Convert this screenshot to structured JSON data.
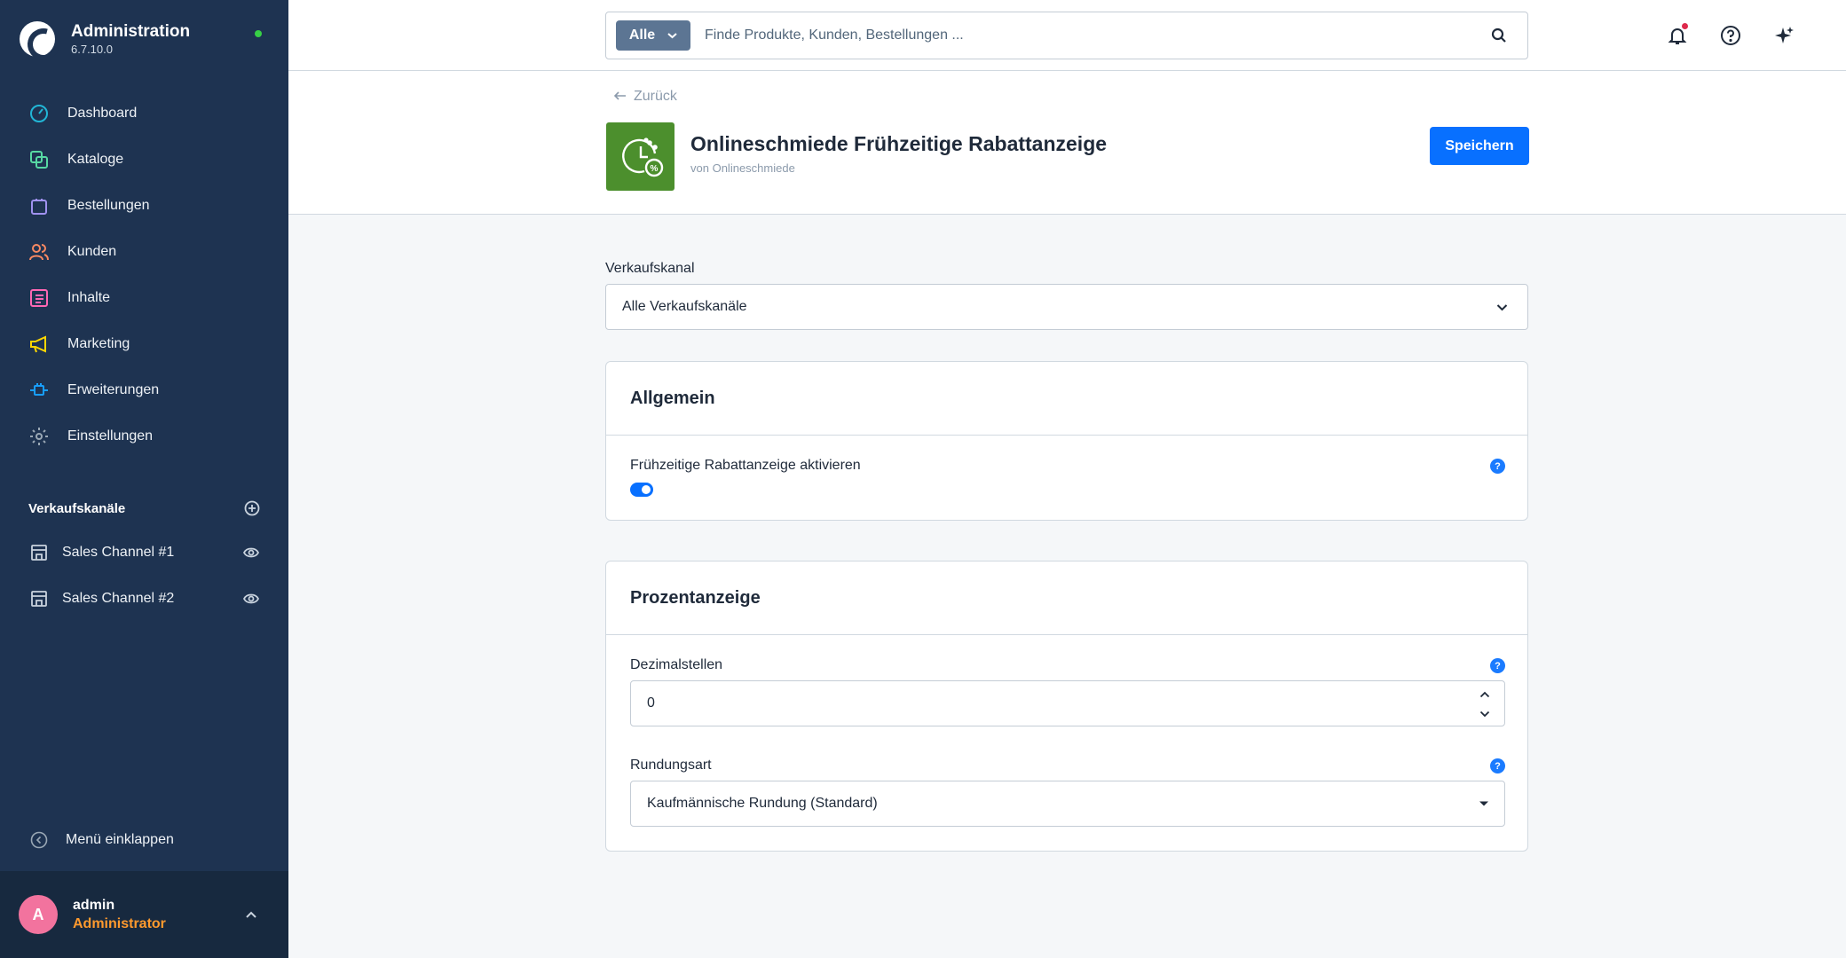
{
  "sidebar": {
    "brand_title": "Administration",
    "brand_version": "6.7.10.0",
    "nav": [
      {
        "label": "Dashboard",
        "icon": "gauge-icon",
        "color": "#22b6d6"
      },
      {
        "label": "Kataloge",
        "icon": "catalog-icon",
        "color": "#57d9a3"
      },
      {
        "label": "Bestellungen",
        "icon": "shopping-bag-icon",
        "color": "#a092f0"
      },
      {
        "label": "Kunden",
        "icon": "users-icon",
        "color": "#f88962"
      },
      {
        "label": "Inhalte",
        "icon": "content-icon",
        "color": "#ff68b4"
      },
      {
        "label": "Marketing",
        "icon": "megaphone-icon",
        "color": "#ffd700"
      },
      {
        "label": "Erweiterungen",
        "icon": "plug-icon",
        "color": "#189eff"
      },
      {
        "label": "Einstellungen",
        "icon": "gear-icon",
        "color": "#9aa8b5"
      }
    ],
    "sales_channels_title": "Verkaufskanäle",
    "sales_channels": [
      {
        "label": "Sales Channel #1"
      },
      {
        "label": "Sales Channel #2"
      }
    ],
    "collapse_label": "Menü einklappen",
    "user": {
      "initial": "A",
      "name": "admin",
      "role": "Administrator"
    }
  },
  "topbar": {
    "search_type": "Alle",
    "search_placeholder": "Finde Produkte, Kunden, Bestellungen ..."
  },
  "page": {
    "back_label": "Zurück",
    "title": "Onlineschmiede Frühzeitige Rabattanzeige",
    "vendor_prefix": "von",
    "vendor_name": "Onlineschmiede",
    "save_label": "Speichern"
  },
  "config": {
    "sales_channel_label": "Verkaufskanal",
    "sales_channel_value": "Alle Verkaufskanäle",
    "general": {
      "title": "Allgemein",
      "toggle_label": "Frühzeitige Rabattanzeige aktivieren",
      "toggle_on": true
    },
    "percent": {
      "title": "Prozentanzeige",
      "decimals_label": "Dezimalstellen",
      "decimals_value": "0",
      "rounding_label": "Rundungsart",
      "rounding_value": "Kaufmännische Rundung (Standard)"
    },
    "help_glyph": "?"
  },
  "colors": {
    "sidebar_bg": "#1e3351",
    "accent": "#0870ff",
    "plugin_icon_bg": "#4c8f2d",
    "user_role": "#ff9a2e",
    "avatar_bg": "#f2739e",
    "status_dot": "#37d046"
  }
}
